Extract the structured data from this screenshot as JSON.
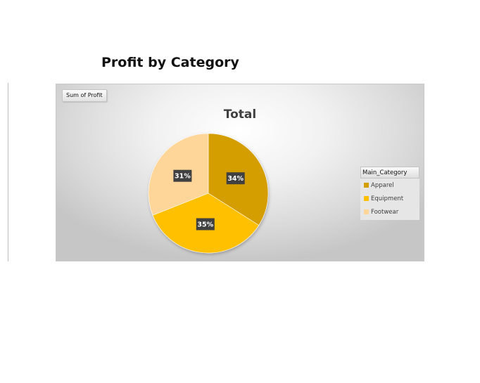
{
  "page": {
    "title": "Profit by Category"
  },
  "pivot": {
    "field_button": "Sum of Profit",
    "legend_header": "Main_Category"
  },
  "chart_data": {
    "type": "pie",
    "title": "Total",
    "categories": [
      "Apparel",
      "Equipment",
      "Footwear"
    ],
    "values": [
      34,
      35,
      31
    ],
    "data_labels": [
      "34%",
      "35%",
      "31%"
    ],
    "colors": [
      "#D49E00",
      "#FFC000",
      "#FFD699"
    ],
    "start_angle_deg": 0,
    "direction": "clockwise",
    "legend_position": "right",
    "series": [
      {
        "values": [
          34,
          35,
          31
        ]
      }
    ]
  }
}
